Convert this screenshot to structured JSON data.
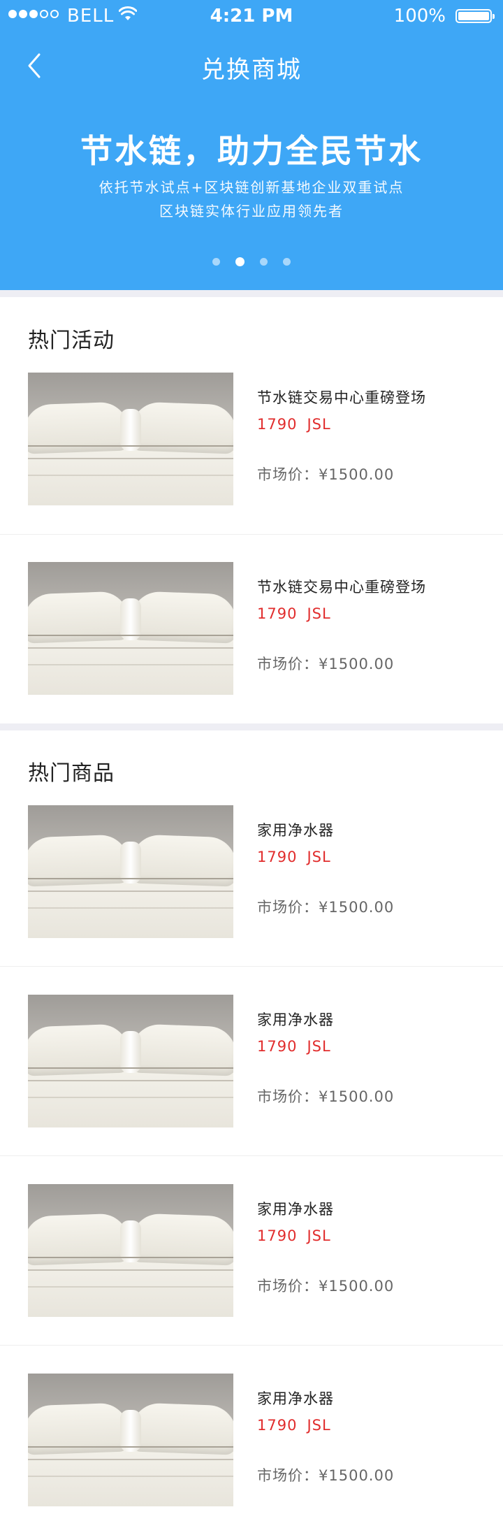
{
  "status_bar": {
    "carrier": "BELL",
    "time": "4:21 PM",
    "battery": "100%"
  },
  "nav": {
    "title": "兑换商城"
  },
  "banner": {
    "title": "节水链，助力全民节水",
    "subtitle_line1": "依托节水试点+区块链创新基地企业双重试点",
    "subtitle_line2": "区块链实体行业应用领先者",
    "active_slide": 2,
    "slide_count": 4
  },
  "sections": {
    "hot_activities": {
      "title": "热门活动",
      "items": [
        {
          "name": "节水链交易中心重磅登场",
          "price": "1790",
          "unit": "JSL",
          "market_price": "市场价：¥1500.00"
        },
        {
          "name": "节水链交易中心重磅登场",
          "price": "1790",
          "unit": "JSL",
          "market_price": "市场价：¥1500.00"
        }
      ]
    },
    "hot_products": {
      "title": "热门商品",
      "items": [
        {
          "name": "家用净水器",
          "price": "1790",
          "unit": "JSL",
          "market_price": "市场价：¥1500.00"
        },
        {
          "name": "家用净水器",
          "price": "1790",
          "unit": "JSL",
          "market_price": "市场价：¥1500.00"
        },
        {
          "name": "家用净水器",
          "price": "1790",
          "unit": "JSL",
          "market_price": "市场价：¥1500.00"
        },
        {
          "name": "家用净水器",
          "price": "1790",
          "unit": "JSL",
          "market_price": "市场价：¥1500.00"
        }
      ]
    }
  },
  "colors": {
    "header_bg": "#3ea7f6",
    "price": "#e12d2d",
    "separator": "#eeeef4"
  }
}
